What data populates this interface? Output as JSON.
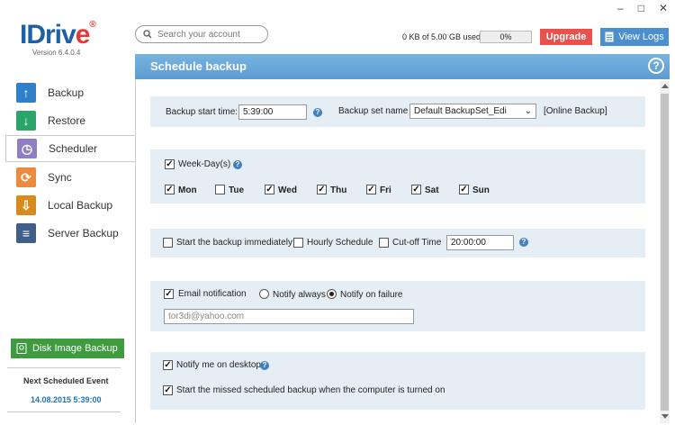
{
  "window": {
    "minimize": "–",
    "maximize": "□",
    "close": "✕"
  },
  "brand": {
    "logo_main": "IDriv",
    "logo_e": "e",
    "reg": "®",
    "version": "Version 6.4.0.4"
  },
  "search": {
    "placeholder": "Search your account",
    "icon": "search-icon"
  },
  "usage": {
    "text": "0 KB of 5.00 GB used",
    "percent_label": "0%"
  },
  "header_buttons": {
    "upgrade": "Upgrade",
    "view_logs": "View Logs"
  },
  "sidebar": {
    "items": [
      {
        "label": "Backup",
        "icon": "backup-icon",
        "color": "#2f80c8"
      },
      {
        "label": "Restore",
        "icon": "restore-icon",
        "color": "#2aa66a"
      },
      {
        "label": "Scheduler",
        "icon": "scheduler-icon",
        "color": "#8e7fc4"
      },
      {
        "label": "Sync",
        "icon": "sync-icon",
        "color": "#ef8a3c"
      },
      {
        "label": "Local Backup",
        "icon": "local-backup-icon",
        "color": "#d98a1c"
      },
      {
        "label": "Server Backup",
        "icon": "server-backup-icon",
        "color": "#3f5f8a"
      }
    ],
    "disk_image_button": "Disk Image Backup",
    "next_event_label": "Next Scheduled Event",
    "next_event_value": "14.08.2015 5:39:00"
  },
  "main": {
    "title": "Schedule backup",
    "start_time_label": "Backup start time:",
    "start_time_value": "5:39:00",
    "backup_set_label": "Backup set name",
    "backup_set_value": "Default BackupSet_Edi",
    "backup_set_type": "[Online Backup]",
    "weekdays_label": "Week-Day(s)",
    "days": [
      {
        "label": "Mon",
        "checked": true
      },
      {
        "label": "Tue",
        "checked": false
      },
      {
        "label": "Wed",
        "checked": true
      },
      {
        "label": "Thu",
        "checked": true
      },
      {
        "label": "Fri",
        "checked": true
      },
      {
        "label": "Sat",
        "checked": true
      },
      {
        "label": "Sun",
        "checked": true
      }
    ],
    "start_immediately_label": "Start the backup immediately",
    "hourly_label": "Hourly Schedule",
    "cutoff_label": "Cut-off Time",
    "cutoff_value": "20:00:00",
    "email_label": "Email notification",
    "notify_always_label": "Notify always",
    "notify_failure_label": "Notify on failure",
    "email_placeholder": "tor3di@yahoo.com",
    "desktop_label": "Notify me on desktop",
    "missed_label": "Start the missed scheduled backup when the computer is turned on"
  }
}
